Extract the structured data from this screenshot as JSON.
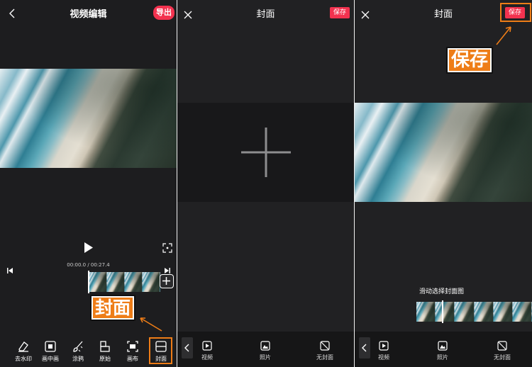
{
  "editor": {
    "title": "视频编辑",
    "export_label": "导出",
    "time_current": "00:00.0",
    "time_separator": " / ",
    "time_total": "00:27.4",
    "cover_callout": "封面",
    "toolbar": [
      {
        "label": "去水印",
        "icon": "eraser-icon"
      },
      {
        "label": "画中画",
        "icon": "pip-icon"
      },
      {
        "label": "涂鸦",
        "icon": "brush-icon"
      },
      {
        "label": "原始",
        "icon": "original-icon"
      },
      {
        "label": "画布",
        "icon": "canvas-icon"
      },
      {
        "label": "封面",
        "icon": "cover-icon"
      }
    ]
  },
  "cover_empty": {
    "title": "封面",
    "save_label": "保存",
    "options": [
      {
        "label": "视频",
        "icon": "video-icon"
      },
      {
        "label": "照片",
        "icon": "photo-icon"
      },
      {
        "label": "无封面",
        "icon": "no-cover-icon"
      }
    ]
  },
  "cover_video": {
    "title": "封面",
    "save_label": "保存",
    "save_callout": "保存",
    "hint": "滑动选择封面图",
    "options": [
      {
        "label": "视频",
        "icon": "video-icon"
      },
      {
        "label": "照片",
        "icon": "photo-icon"
      },
      {
        "label": "无封面",
        "icon": "no-cover-icon"
      }
    ]
  },
  "colors": {
    "accent": "#f3324f",
    "callout": "#ee7d17",
    "background": "#1d1d1f"
  }
}
